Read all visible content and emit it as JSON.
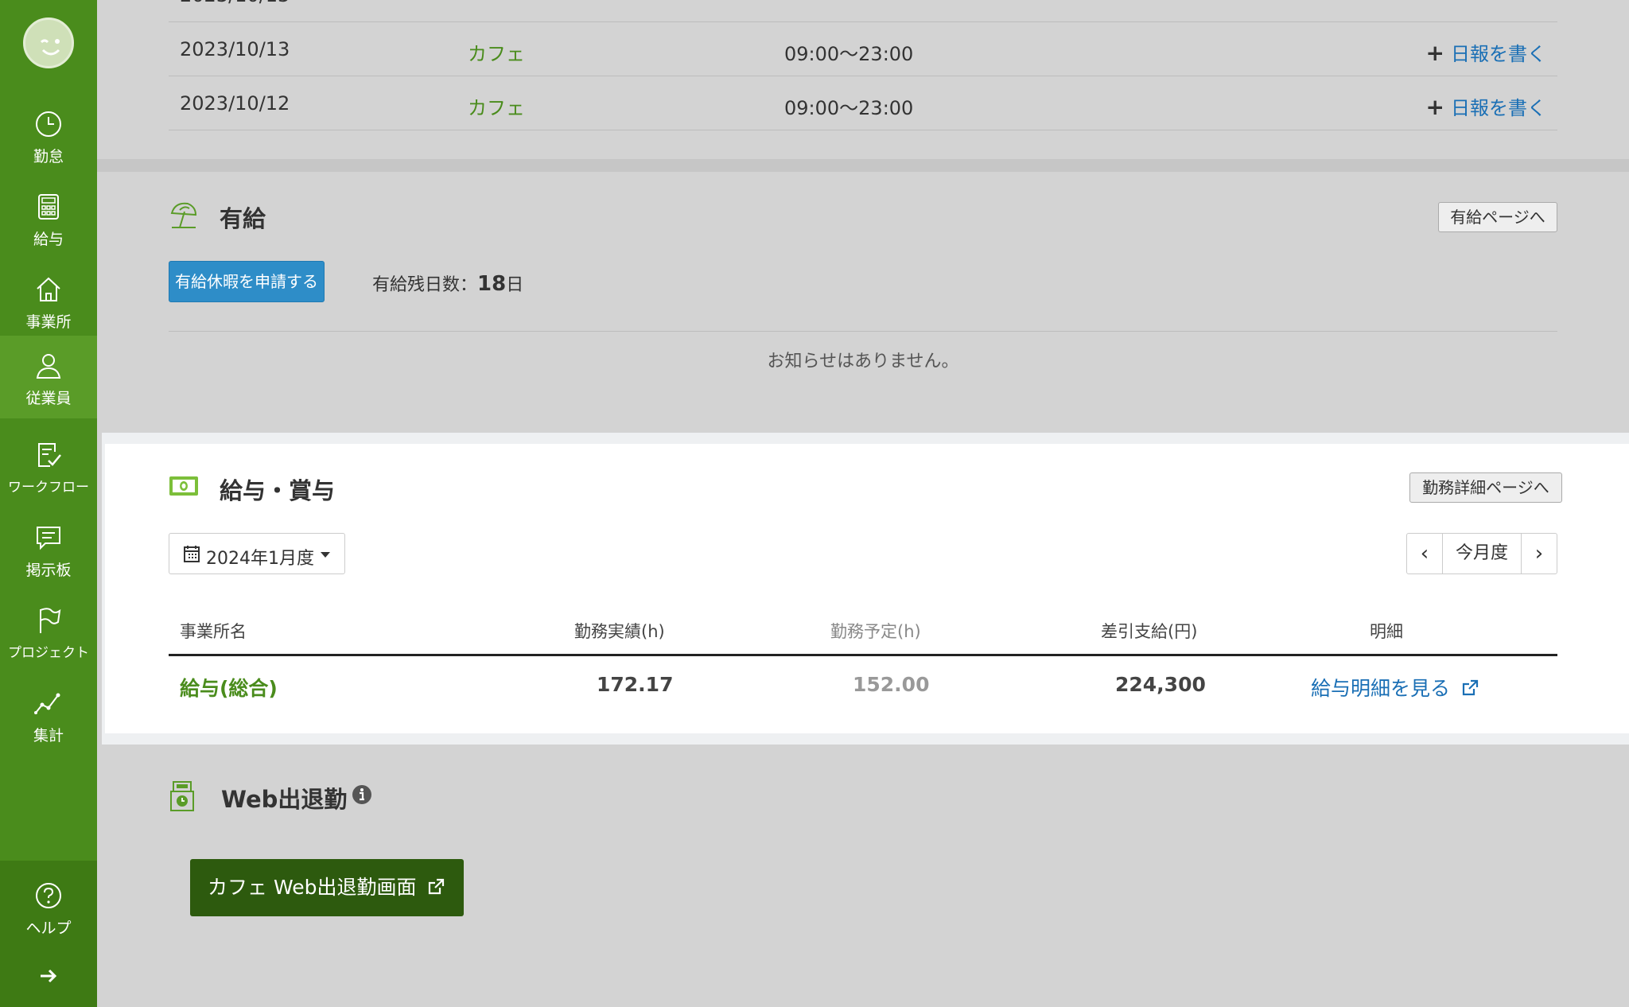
{
  "sidebar": {
    "items": [
      {
        "label": "勤怠",
        "icon": "clock-icon"
      },
      {
        "label": "給与",
        "icon": "calculator-icon"
      },
      {
        "label": "事業所",
        "icon": "home-icon"
      },
      {
        "label": "従業員",
        "icon": "person-icon"
      },
      {
        "label": "ワークフロー",
        "icon": "clipboard-check-icon"
      },
      {
        "label": "掲示板",
        "icon": "chat-icon"
      },
      {
        "label": "プロジェクト",
        "icon": "flag-icon"
      },
      {
        "label": "集計",
        "icon": "line-chart-icon"
      }
    ],
    "help_label": "ヘルプ"
  },
  "shift_rows": [
    {
      "date": "2023/10/13",
      "office": "カフェ",
      "time": "09:00～23:00",
      "action": "日報を書く"
    },
    {
      "date": "2023/10/12",
      "office": "カフェ",
      "time": "09:00～23:00",
      "action": "日報を書く"
    }
  ],
  "paid_leave": {
    "title": "有給",
    "page_button": "有給ページへ",
    "apply_button": "有給休暇を申請する",
    "remaining_label": "有給残日数：",
    "remaining_value": "18",
    "remaining_unit": "日",
    "no_notice": "お知らせはありません。"
  },
  "salary": {
    "title": "給与・賞与",
    "detail_button": "勤務詳細ページへ",
    "period": "2024年1月度",
    "pager": {
      "prev": "‹",
      "current": "今月度",
      "next": "›"
    },
    "headers": {
      "office": "事業所名",
      "actual": "勤務実績(h)",
      "planned": "勤務予定(h)",
      "net_pay": "差引支給(円)",
      "statement": "明細"
    },
    "row": {
      "office": "給与(総合)",
      "actual": "172.17",
      "planned": "152.00",
      "net_pay": "224,300",
      "statement_link": "給与明細を見る"
    }
  },
  "web_attendance": {
    "title": "Web出退勤",
    "button": "カフェ Web出退勤画面"
  },
  "colors": {
    "sidebar": "#4a8c1c",
    "accent_green": "#4a8c1c",
    "link_blue": "#1a6fb5",
    "primary_button": "#2e8dc8",
    "dark_green_button": "#2d5a0e"
  }
}
